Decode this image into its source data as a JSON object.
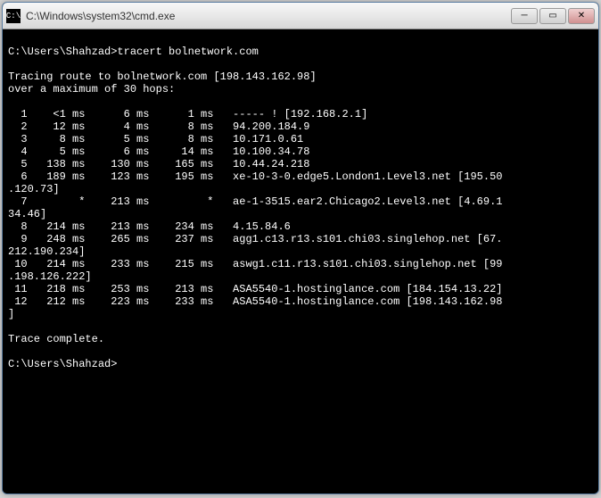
{
  "titlebar": {
    "icon_label": "C:\\",
    "title": "C:\\Windows\\system32\\cmd.exe"
  },
  "window_controls": {
    "minimize": "─",
    "maximize": "▭",
    "close": "✕"
  },
  "console": {
    "prompt1": "C:\\Users\\Shahzad>",
    "command": "tracert bolnetwork.com",
    "trace_header_1": "Tracing route to bolnetwork.com [198.143.162.98]",
    "trace_header_2": "over a maximum of 30 hops:",
    "hops": [
      {
        "n": "1",
        "t1": "<1 ms",
        "t2": "6 ms",
        "t3": "1 ms",
        "dest": "----- ! [192.168.2.1]"
      },
      {
        "n": "2",
        "t1": "12 ms",
        "t2": "4 ms",
        "t3": "8 ms",
        "dest": "94.200.184.9"
      },
      {
        "n": "3",
        "t1": "8 ms",
        "t2": "5 ms",
        "t3": "8 ms",
        "dest": "10.171.0.61"
      },
      {
        "n": "4",
        "t1": "5 ms",
        "t2": "6 ms",
        "t3": "14 ms",
        "dest": "10.100.34.78"
      },
      {
        "n": "5",
        "t1": "138 ms",
        "t2": "130 ms",
        "t3": "165 ms",
        "dest": "10.44.24.218"
      },
      {
        "n": "6",
        "t1": "189 ms",
        "t2": "123 ms",
        "t3": "195 ms",
        "dest": "xe-10-3-0.edge5.London1.Level3.net [195.50.120.73]"
      },
      {
        "n": "7",
        "t1": "*",
        "t2": "213 ms",
        "t3": "*",
        "dest": "ae-1-3515.ear2.Chicago2.Level3.net [4.69.134.46]"
      },
      {
        "n": "8",
        "t1": "214 ms",
        "t2": "213 ms",
        "t3": "234 ms",
        "dest": "4.15.84.6"
      },
      {
        "n": "9",
        "t1": "248 ms",
        "t2": "265 ms",
        "t3": "237 ms",
        "dest": "agg1.c13.r13.s101.chi03.singlehop.net [67.212.190.234]"
      },
      {
        "n": "10",
        "t1": "214 ms",
        "t2": "233 ms",
        "t3": "215 ms",
        "dest": "aswg1.c11.r13.s101.chi03.singlehop.net [99.198.126.222]"
      },
      {
        "n": "11",
        "t1": "218 ms",
        "t2": "253 ms",
        "t3": "213 ms",
        "dest": "ASA5540-1.hostinglance.com [184.154.13.22]"
      },
      {
        "n": "12",
        "t1": "212 ms",
        "t2": "223 ms",
        "t3": "233 ms",
        "dest": "ASA5540-1.hostinglance.com [198.143.162.98]"
      }
    ],
    "complete": "Trace complete.",
    "prompt2": "C:\\Users\\Shahzad>"
  }
}
